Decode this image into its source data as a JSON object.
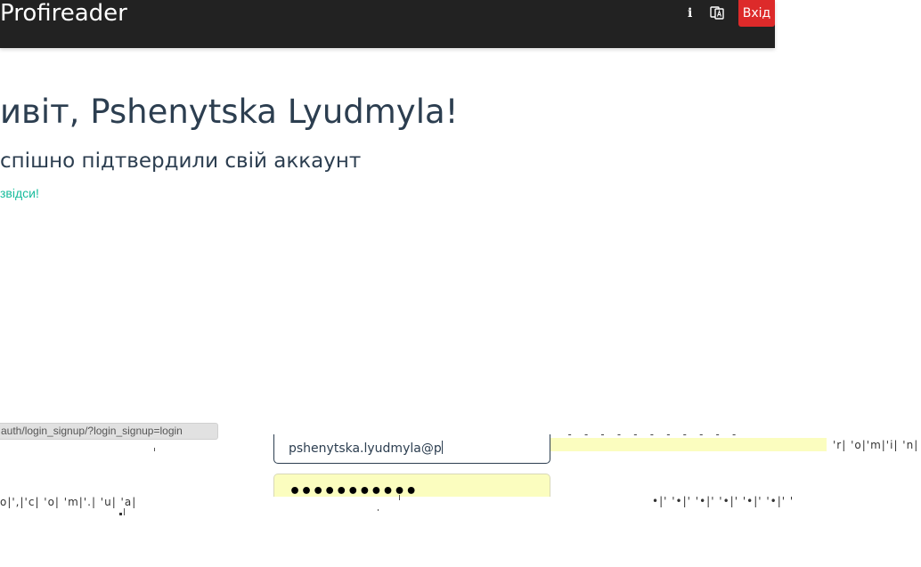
{
  "navbar": {
    "brand": "Profireader",
    "icons": [
      "info-icon",
      "language-icon"
    ],
    "login_label": "Вхід"
  },
  "main": {
    "greeting": "ивіт, Pshenytska Lyudmyla!",
    "subtitle": "спішно підтвердили свій аккаунт",
    "link_text": "звідси!"
  },
  "status_bar": {
    "url": "auth/login_signup/?login_signup=login"
  },
  "form": {
    "email_value": "pshenytska.lyudmyla@p",
    "password_mask": "•••••••••••"
  },
  "artifacts": {
    "dashes": "- - - - - - - - - - -",
    "right_fragment": "'r| 'o|'m|'i| 'n| 'f| '",
    "left_fragment": "o|',|'c| 'o|  'm|'.| 'u| 'a|",
    "bottom_fragment": "•|'  '•|'  '•|'  '•|'  '•|'  '•|'  '"
  },
  "colors": {
    "navbar_bg": "#222222",
    "login_button": "#dd2a2a",
    "link": "#18bc9c",
    "heading": "#2c3e50",
    "autofill_bg": "#fbfdbf"
  }
}
